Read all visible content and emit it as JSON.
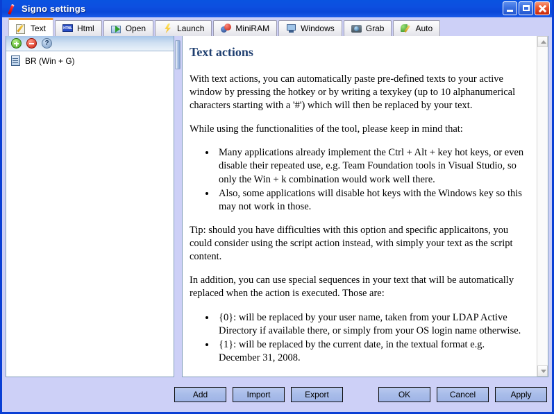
{
  "window": {
    "title": "Signo settings",
    "icon": "pen-icon",
    "controls": {
      "minimize": "Minimize",
      "maximize": "Maximize",
      "close": "Close"
    }
  },
  "tabs": [
    {
      "label": "Text",
      "icon": "text-pencil-icon",
      "active": true
    },
    {
      "label": "Html",
      "icon": "html-badge-icon",
      "active": false
    },
    {
      "label": "Open",
      "icon": "open-folder-icon",
      "active": false
    },
    {
      "label": "Launch",
      "icon": "lightning-icon",
      "active": false
    },
    {
      "label": "MiniRAM",
      "icon": "spheres-icon",
      "active": false
    },
    {
      "label": "Windows",
      "icon": "monitor-icon",
      "active": false
    },
    {
      "label": "Grab",
      "icon": "camera-icon",
      "active": false
    },
    {
      "label": "Auto",
      "icon": "auto-pencil-icon",
      "active": false
    }
  ],
  "left_panel": {
    "toolbar": {
      "add_label": "Add item",
      "remove_label": "Remove item",
      "help_label": "Help"
    },
    "items": [
      {
        "label": "BR (Win + G)",
        "icon": "document-icon"
      }
    ]
  },
  "content": {
    "heading": "Text actions",
    "paragraph1": "With text actions, you can automatically paste pre-defined texts to your active window by pressing the hotkey or by writing a texykey (up to 10 alphanumerical characters starting with a '#') which will then be replaced by your text.",
    "paragraph2": "While using the functionalities of the tool, please keep in mind that:",
    "bullets1": [
      "Many applications already implement the Ctrl + Alt + key hot keys, or even disable their repeated use, e.g. Team Foundation tools in Visual Studio, so only the Win + k combination would work well there.",
      "Also, some applications will disable hot keys with the Windows key so this may not work in those."
    ],
    "paragraph3": "Tip: should you have difficulties with this option and specific applicaitons, you could consider using the script action instead, with simply your text as the script content.",
    "paragraph4": "In addition, you can use special sequences in your text that will be automatically replaced when the action is executed. Those are:",
    "bullets2": [
      "{0}: will be replaced by your user name, taken from your LDAP Active Directory if available there, or simply from your OS login name otherwise.",
      "{1}: will be replaced by the current date, in the textual format e.g. December 31, 2008."
    ]
  },
  "scrollbar": {
    "up_label": "Scroll up",
    "down_label": "Scroll down"
  },
  "footer": {
    "add": "Add",
    "import": "Import",
    "export": "Export",
    "ok": "OK",
    "cancel": "Cancel",
    "apply": "Apply"
  },
  "colors": {
    "titlebar": "#0b47d8",
    "window_frame": "#0a3fd4",
    "dialog_background": "#cdd0f7",
    "active_tab_accent": "#f0922b",
    "heading": "#1f3f70",
    "button_face": "#a8bce9"
  }
}
